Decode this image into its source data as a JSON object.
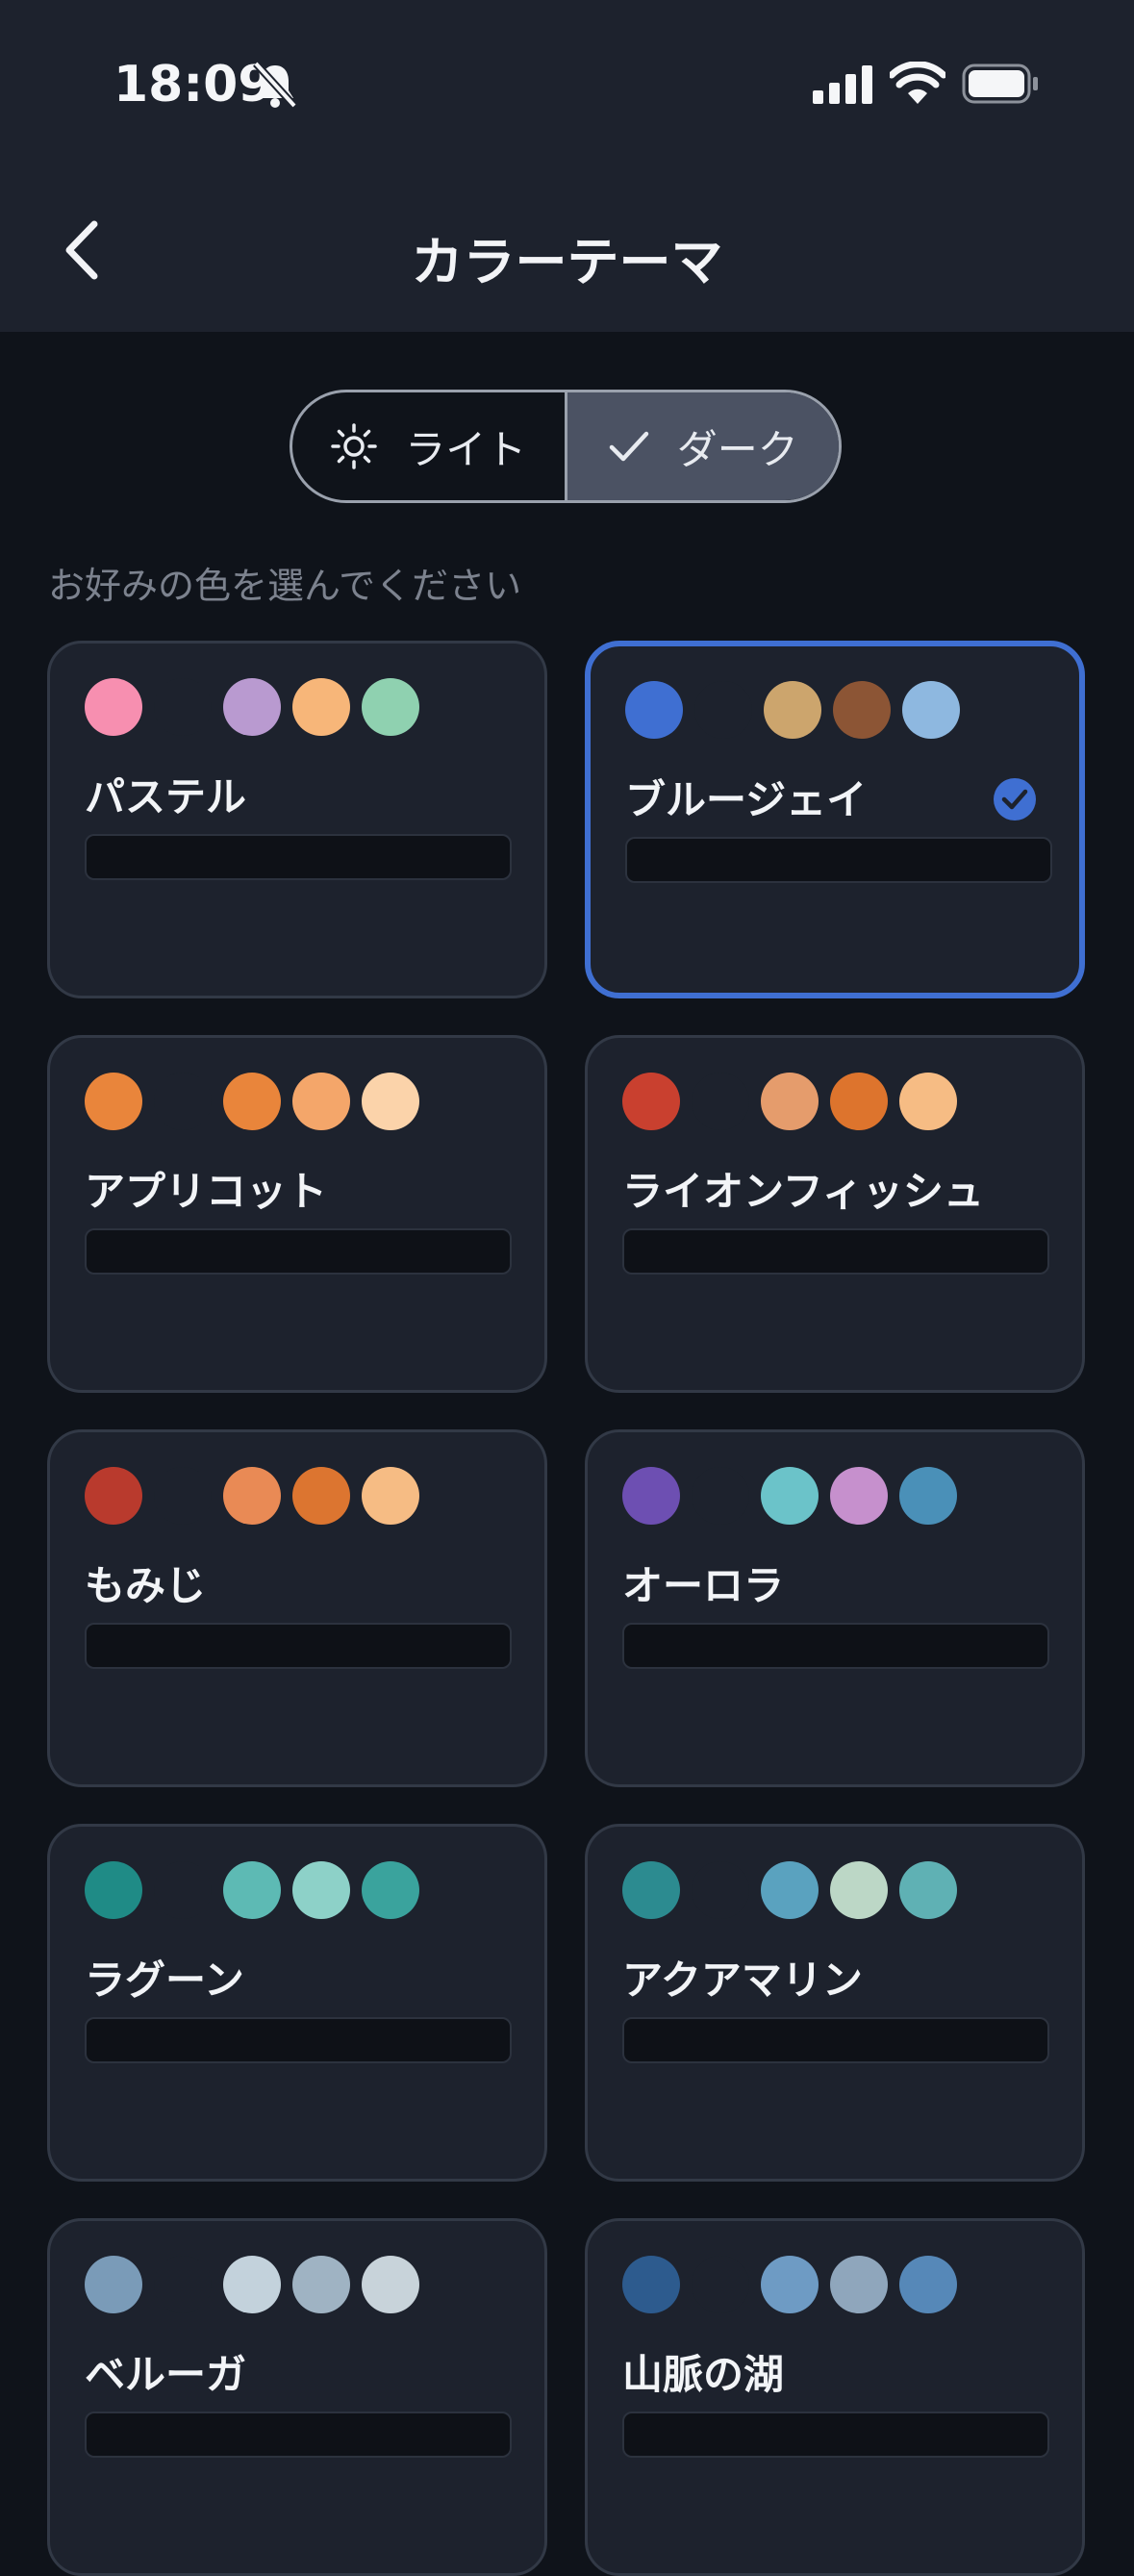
{
  "status": {
    "time": "18:09"
  },
  "header": {
    "title": "カラーテーマ"
  },
  "mode_toggle": {
    "light_label": "ライト",
    "dark_label": "ダーク",
    "selected": "dark"
  },
  "subtitle": "お好みの色を選んでください",
  "themes": [
    {
      "name": "パステル",
      "colors": [
        "#f78fb0",
        "#1d222d",
        "#b99ad0",
        "#f7b679",
        "#8fd1b0"
      ],
      "selected": false
    },
    {
      "name": "ブルージェイ",
      "colors": [
        "#3f6fd2",
        "#1d222d",
        "#cca56d",
        "#8c5535",
        "#8eb8e0"
      ],
      "selected": true
    },
    {
      "name": "アプリコット",
      "colors": [
        "#e9853b",
        "#1d222d",
        "#e9853b",
        "#f4a66a",
        "#fbd3aa"
      ],
      "selected": false
    },
    {
      "name": "ライオンフィッシュ",
      "colors": [
        "#c9402f",
        "#1d222d",
        "#e59c6c",
        "#dd742d",
        "#f6bc84"
      ],
      "selected": false
    },
    {
      "name": "もみじ",
      "colors": [
        "#b93a2d",
        "#1d222d",
        "#e98a55",
        "#dc7530",
        "#f6bc84"
      ],
      "selected": false
    },
    {
      "name": "オーロラ",
      "colors": [
        "#6d4fb2",
        "#1d222d",
        "#6bc3c9",
        "#c690cd",
        "#4a90b8"
      ],
      "selected": false
    },
    {
      "name": "ラグーン",
      "colors": [
        "#1f8b86",
        "#1d222d",
        "#5dbab4",
        "#8dd1c8",
        "#3aa39d"
      ],
      "selected": false
    },
    {
      "name": "アクアマリン",
      "colors": [
        "#2c8b90",
        "#1d222d",
        "#5aa2bf",
        "#bcd7c6",
        "#5fb1b4"
      ],
      "selected": false
    },
    {
      "name": "ベルーガ",
      "colors": [
        "#7a9bb8",
        "#1d222d",
        "#c3d2dc",
        "#9fb3c3",
        "#c8d3da"
      ],
      "selected": false
    },
    {
      "name": "山脈の湖",
      "colors": [
        "#2d5b8e",
        "#1d222d",
        "#6e9bc4",
        "#8fa6bc",
        "#5688b8"
      ],
      "selected": false
    }
  ]
}
